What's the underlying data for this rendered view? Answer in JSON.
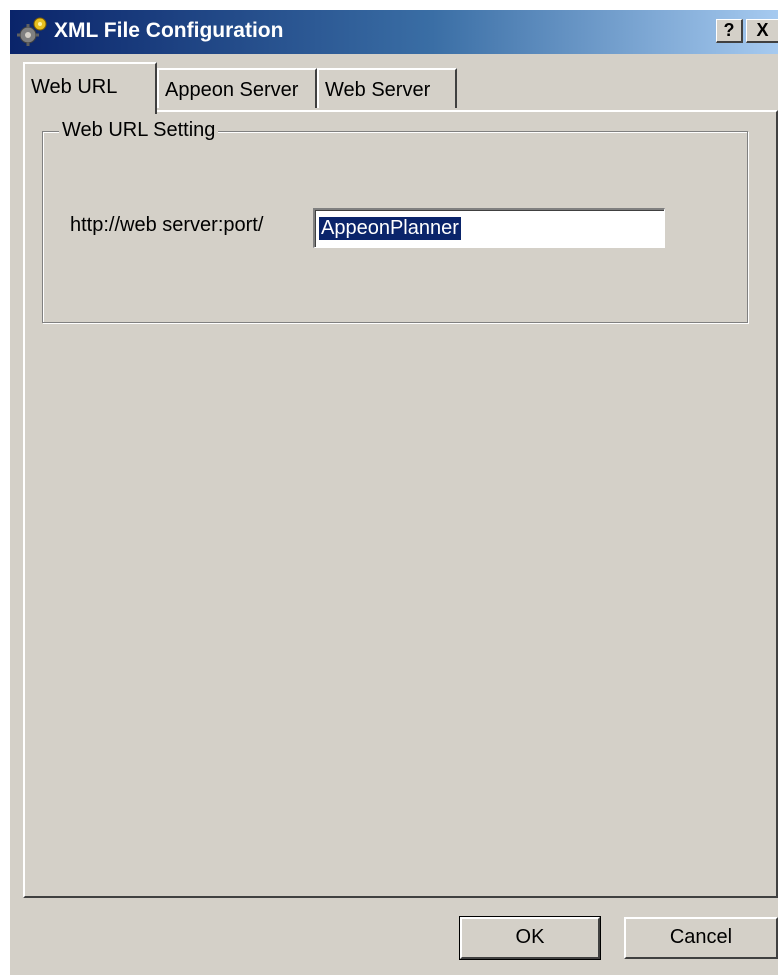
{
  "window": {
    "title": "XML File Configuration",
    "icon": "gear-icon",
    "help_label": "?",
    "close_label": "X"
  },
  "tabs": [
    {
      "label": "Web URL",
      "active": true
    },
    {
      "label": "Appeon Server",
      "active": false
    },
    {
      "label": "Web Server",
      "active": false
    }
  ],
  "web_url": {
    "group_label": "Web URL Setting",
    "prefix_label": "http://web server:port/",
    "value": "AppeonPlanner"
  },
  "buttons": {
    "ok_label": "OK",
    "cancel_label": "Cancel"
  },
  "colors": {
    "titlebar_start": "#0a246a",
    "titlebar_end": "#a6caf0",
    "selection": "#0a246a",
    "face": "#d4d0c8"
  }
}
